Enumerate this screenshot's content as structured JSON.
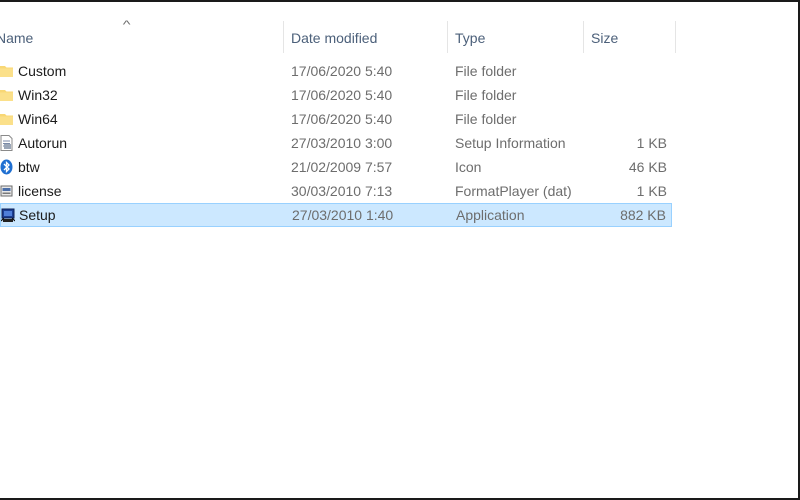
{
  "columns": {
    "name": "Name",
    "date_modified": "Date modified",
    "type": "Type",
    "size": "Size",
    "sort_indicator": "^"
  },
  "files": [
    {
      "name": "Custom",
      "date": "17/06/2020 5:40",
      "type": "File folder",
      "size": "",
      "icon": "folder-icon",
      "selected": false
    },
    {
      "name": "Win32",
      "date": "17/06/2020 5:40",
      "type": "File folder",
      "size": "",
      "icon": "folder-icon",
      "selected": false
    },
    {
      "name": "Win64",
      "date": "17/06/2020 5:40",
      "type": "File folder",
      "size": "",
      "icon": "folder-icon",
      "selected": false
    },
    {
      "name": "Autorun",
      "date": "27/03/2010 3:00",
      "type": "Setup Information",
      "size": "1 KB",
      "icon": "setup-info-file-icon",
      "selected": false
    },
    {
      "name": "btw",
      "date": "21/02/2009 7:57",
      "type": "Icon",
      "size": "46 KB",
      "icon": "bluetooth-icon",
      "selected": false
    },
    {
      "name": "license",
      "date": "30/03/2010 7:13",
      "type": "FormatPlayer (dat)",
      "size": "1 KB",
      "icon": "dat-file-icon",
      "selected": false
    },
    {
      "name": "Setup",
      "date": "27/03/2010 1:40",
      "type": "Application",
      "size": "882 KB",
      "icon": "application-icon",
      "selected": true
    }
  ],
  "colors": {
    "selection_background": "#cce8ff",
    "selection_border": "#99d1ff",
    "header_text": "#4c607a",
    "folder_yellow": "#f8d775"
  }
}
